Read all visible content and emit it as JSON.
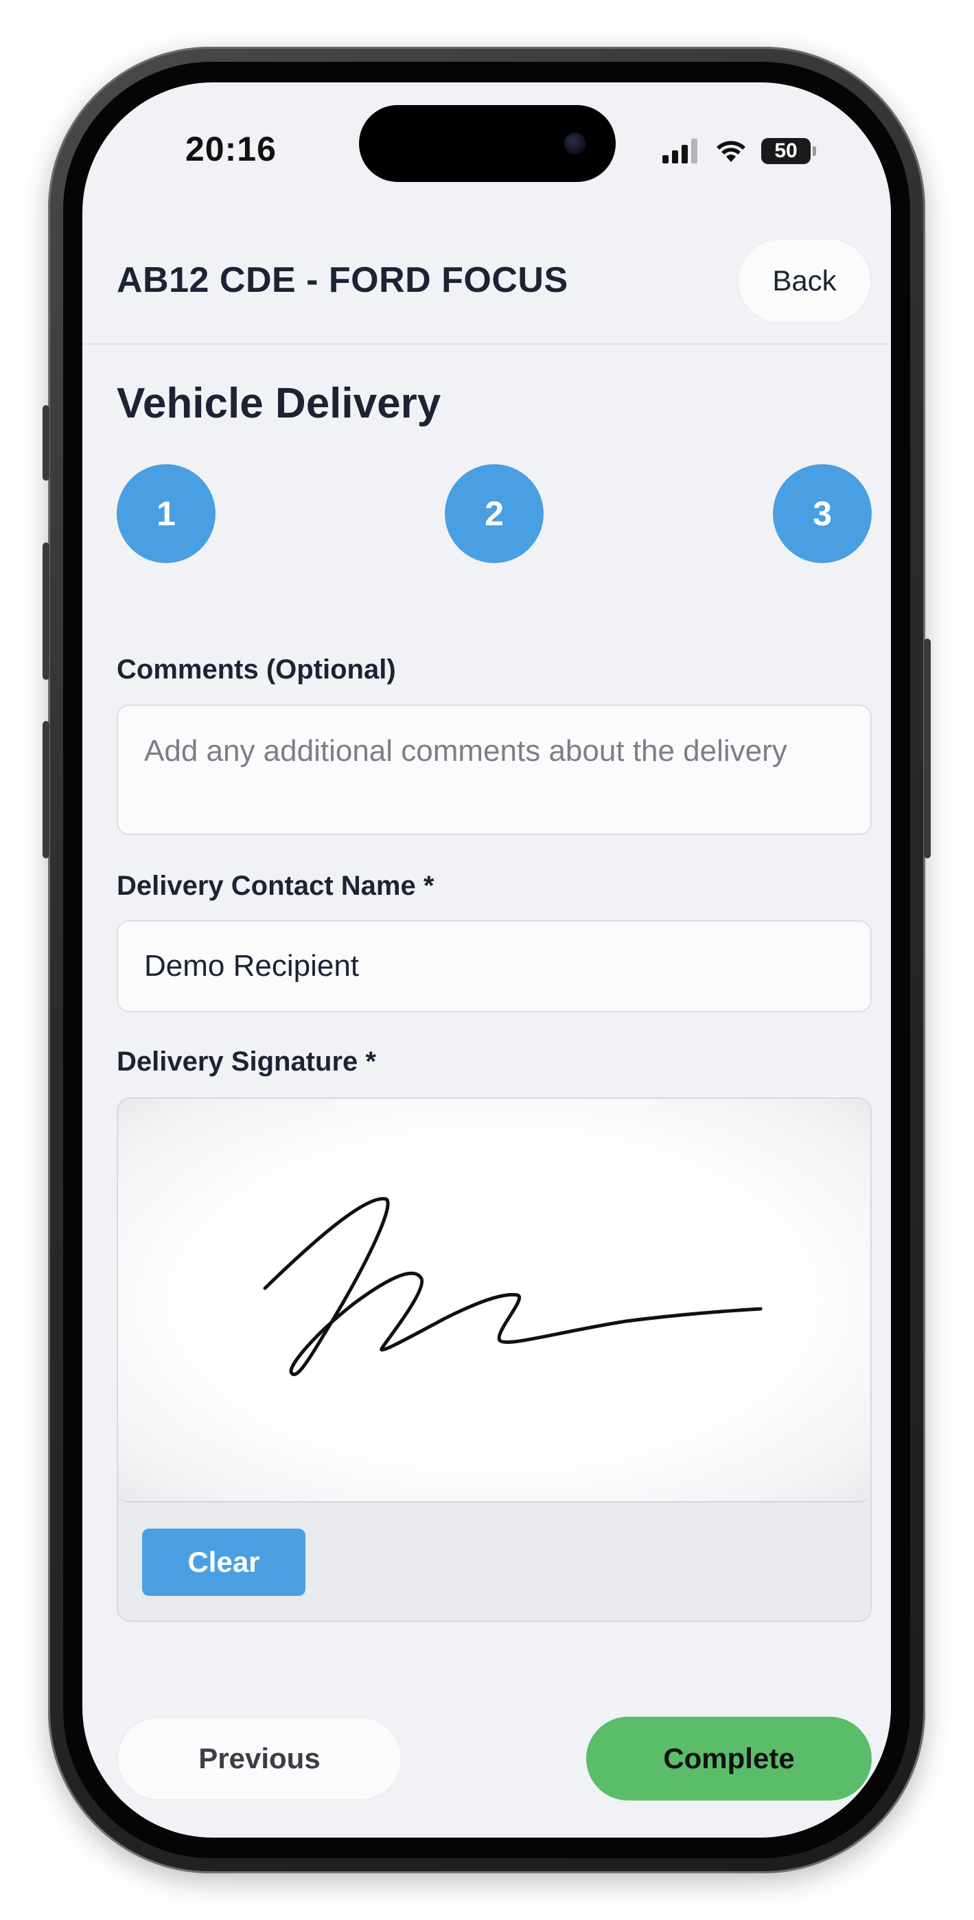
{
  "status_bar": {
    "time": "20:16",
    "battery": "50"
  },
  "header": {
    "title": "AB12 CDE - FORD FOCUS",
    "back_label": "Back"
  },
  "page": {
    "title": "Vehicle Delivery"
  },
  "stepper": {
    "steps": [
      "1",
      "2",
      "3"
    ]
  },
  "form": {
    "comments": {
      "label": "Comments (Optional)",
      "placeholder": "Add any additional comments about the delivery",
      "value": ""
    },
    "contact_name": {
      "label": "Delivery Contact Name *",
      "value": "Demo Recipient"
    },
    "signature": {
      "label": "Delivery Signature *",
      "clear_label": "Clear"
    }
  },
  "footer": {
    "previous_label": "Previous",
    "complete_label": "Complete"
  },
  "colors": {
    "accent_blue": "#4a9fe3",
    "complete_green": "#5bbd6a",
    "background": "#f1f2f5"
  }
}
